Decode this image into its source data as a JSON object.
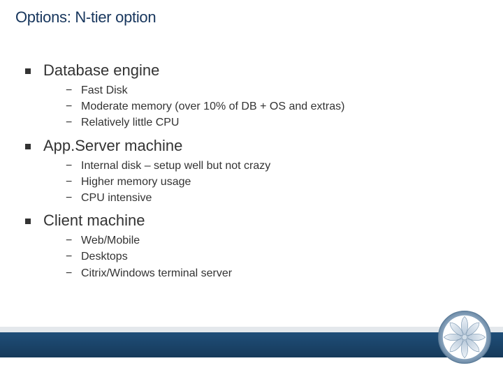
{
  "title": "Options: N-tier option",
  "sections": [
    {
      "heading": "Database engine",
      "items": [
        "Fast Disk",
        "Moderate memory (over 10% of DB + OS and extras)",
        "Relatively little CPU"
      ]
    },
    {
      "heading": "App.Server machine",
      "items": [
        "Internal disk – setup well but not crazy",
        "Higher memory usage",
        "CPU intensive"
      ]
    },
    {
      "heading": "Client machine",
      "items": [
        "Web/Mobile",
        "Desktops",
        "Citrix/Windows terminal server"
      ]
    }
  ],
  "colors": {
    "title": "#17365d",
    "body_text": "#333333",
    "footer_band": "#1f4e79",
    "logo_ring": "#8aa8c2",
    "logo_petal": "#c9d6e3"
  },
  "icons": {
    "logo": "snowflake-star-logo"
  }
}
